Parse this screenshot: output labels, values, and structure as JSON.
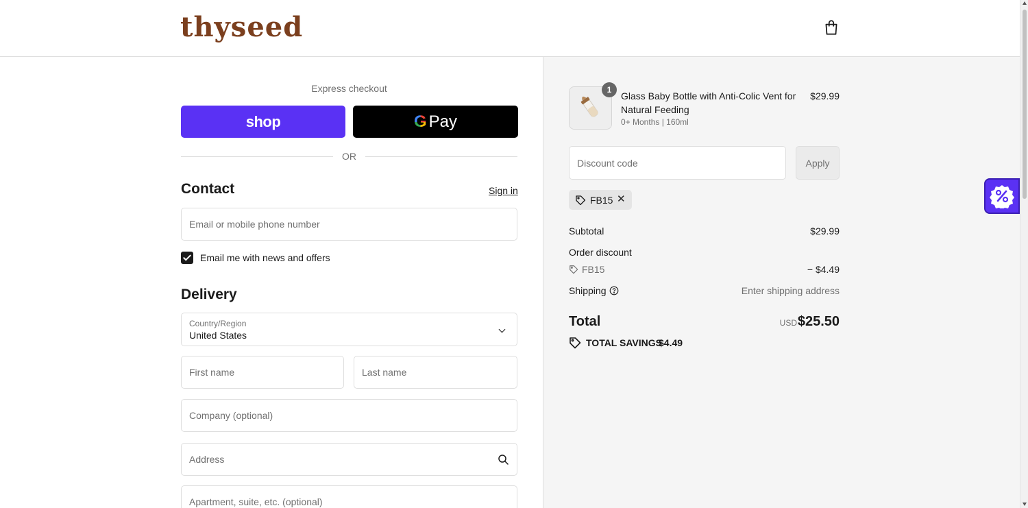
{
  "brand": {
    "logo_text": "thyseed"
  },
  "express": {
    "label": "Express checkout",
    "shop_label": "shop",
    "gpay_label": "Pay",
    "or_text": "OR"
  },
  "contact": {
    "title": "Contact",
    "signin_label": "Sign in",
    "email_placeholder": "Email or mobile phone number",
    "newsletter_label": "Email me with news and offers",
    "newsletter_checked": true
  },
  "delivery": {
    "title": "Delivery",
    "country_label": "Country/Region",
    "country_value": "United States",
    "first_name_placeholder": "First name",
    "last_name_placeholder": "Last name",
    "company_placeholder": "Company (optional)",
    "address_placeholder": "Address",
    "apartment_placeholder": "Apartment, suite, etc. (optional)"
  },
  "order": {
    "item": {
      "quantity": "1",
      "name": "Glass Baby Bottle with Anti-Colic Vent for Natural Feeding",
      "variant": "0+ Months | 160ml",
      "price": "$29.99"
    },
    "discount": {
      "placeholder": "Discount code",
      "apply_label": "Apply",
      "applied_code": "FB15"
    },
    "summary": {
      "subtotal_label": "Subtotal",
      "subtotal_value": "$29.99",
      "order_discount_label": "Order discount",
      "discount_code": "FB15",
      "discount_value": "− $4.49",
      "shipping_label": "Shipping",
      "shipping_value": "Enter shipping address",
      "total_label": "Total",
      "currency": "USD",
      "total_value": "$25.50",
      "savings_label": "TOTAL SAVINGS",
      "savings_value": "$4.49"
    }
  },
  "colors": {
    "shop_pay": "#5a31f4",
    "brand": "#7b3f1e",
    "panel_bg": "#f5f5f5"
  },
  "icons": {
    "cart": "shopping-bag-icon",
    "tag": "tag-icon",
    "help": "question-circle-icon",
    "search": "search-icon",
    "promo": "percent-badge-icon"
  }
}
